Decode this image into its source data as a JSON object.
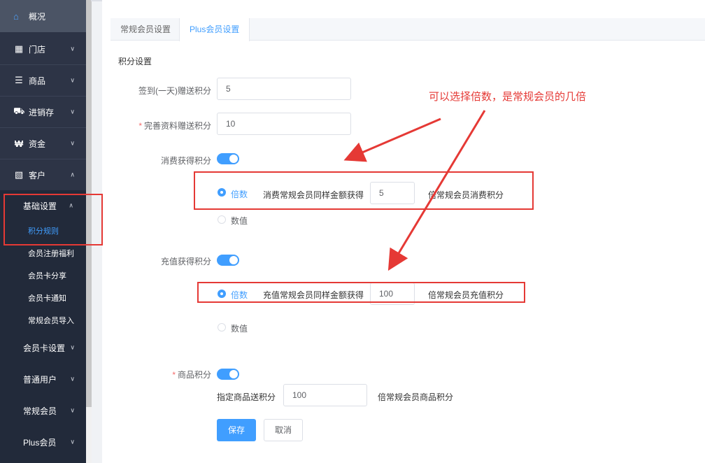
{
  "sidebar": {
    "top": {
      "label": "概况",
      "icon": "home-icon"
    },
    "items": [
      {
        "label": "门店",
        "icon": "store-icon"
      },
      {
        "label": "商品",
        "icon": "list-icon"
      },
      {
        "label": "进销存",
        "icon": "truck-icon"
      },
      {
        "label": "资金",
        "icon": "won-icon"
      },
      {
        "label": "客户",
        "icon": "id-card-icon"
      }
    ],
    "basic_settings": "基础设置",
    "sub_items": [
      "积分规则",
      "会员注册福利",
      "会员卡分享",
      "会员卡通知",
      "常规会员导入"
    ],
    "groups": [
      "会员卡设置",
      "普通用户",
      "常规会员",
      "Plus会员"
    ]
  },
  "tabs": [
    "常规会员设置",
    "Plus会员设置"
  ],
  "form": {
    "section_title": "积分设置",
    "signin_label": "签到(一天)赠送积分",
    "signin_value": "5",
    "profile_required": "*",
    "profile_label": "完善资料赠送积分",
    "profile_value": "10",
    "consume_label": "消费获得积分",
    "consume_radio_multiple": "倍数",
    "consume_desc": "消费常规会员同样金额获得",
    "consume_value": "5",
    "consume_suffix": "倍常规会员消费积分",
    "consume_radio_value": "数值",
    "recharge_label": "充值获得积分",
    "recharge_radio_multiple": "倍数",
    "recharge_desc": "充值常规会员同样金额获得",
    "recharge_value": "100",
    "recharge_suffix": "倍常规会员充值积分",
    "recharge_radio_value": "数值",
    "goods_required": "*",
    "goods_label": "商品积分",
    "goods_desc": "指定商品送积分",
    "goods_value": "100",
    "goods_suffix": "倍常规会员商品积分",
    "save": "保存",
    "cancel": "取消"
  },
  "annotation": "可以选择倍数，是常规会员的几倍",
  "colors": {
    "accent": "#409eff",
    "sidebar": "#2d3446",
    "annotation": "#e53935"
  }
}
